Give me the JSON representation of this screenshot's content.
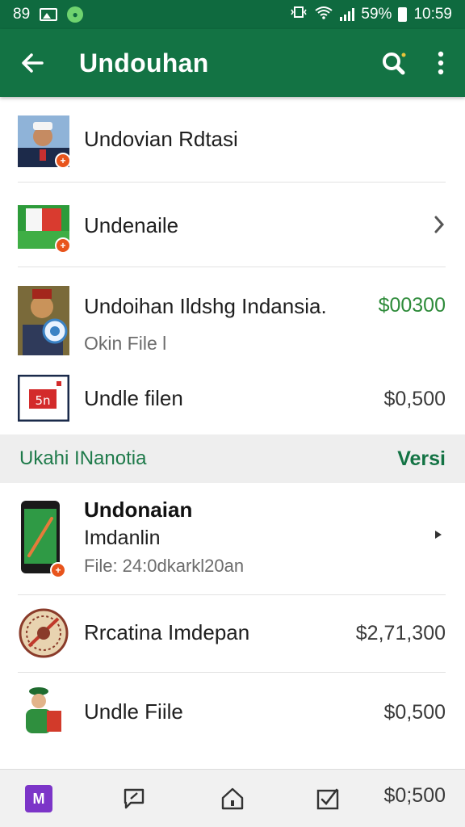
{
  "status_bar": {
    "left_text": "89",
    "right_percent": "59%",
    "time": "10:59"
  },
  "app_bar": {
    "title": "Undouhan"
  },
  "list_items": [
    {
      "title": "Undovian Rdtasi",
      "price": ""
    },
    {
      "title": "Undenaile",
      "price": ""
    },
    {
      "title": "Undoihan Ildshg Indansia.",
      "price": "$00300",
      "subtitle": "Okin File l"
    },
    {
      "title": "Undle filen",
      "price": "$0,500"
    }
  ],
  "section": {
    "title": "Ukahi INanotia",
    "action": "Versi"
  },
  "section_items": [
    {
      "title": "Undonaian",
      "line2": "Imdanlin",
      "line3": "File: 24:0dkarkl20an"
    },
    {
      "title": "Rrcatina Imdepan",
      "price": "$2,71,300"
    },
    {
      "title": "Undle Fiile",
      "price": "$0,500"
    }
  ],
  "bottom_nav": {
    "m_label": "M",
    "price": "$0;500"
  },
  "colors": {
    "status_bar": "#0f6a3f",
    "app_bar": "#137344",
    "accent_green": "#2e8b3a",
    "badge": "#e8541c",
    "nav_m": "#7c35c8"
  }
}
